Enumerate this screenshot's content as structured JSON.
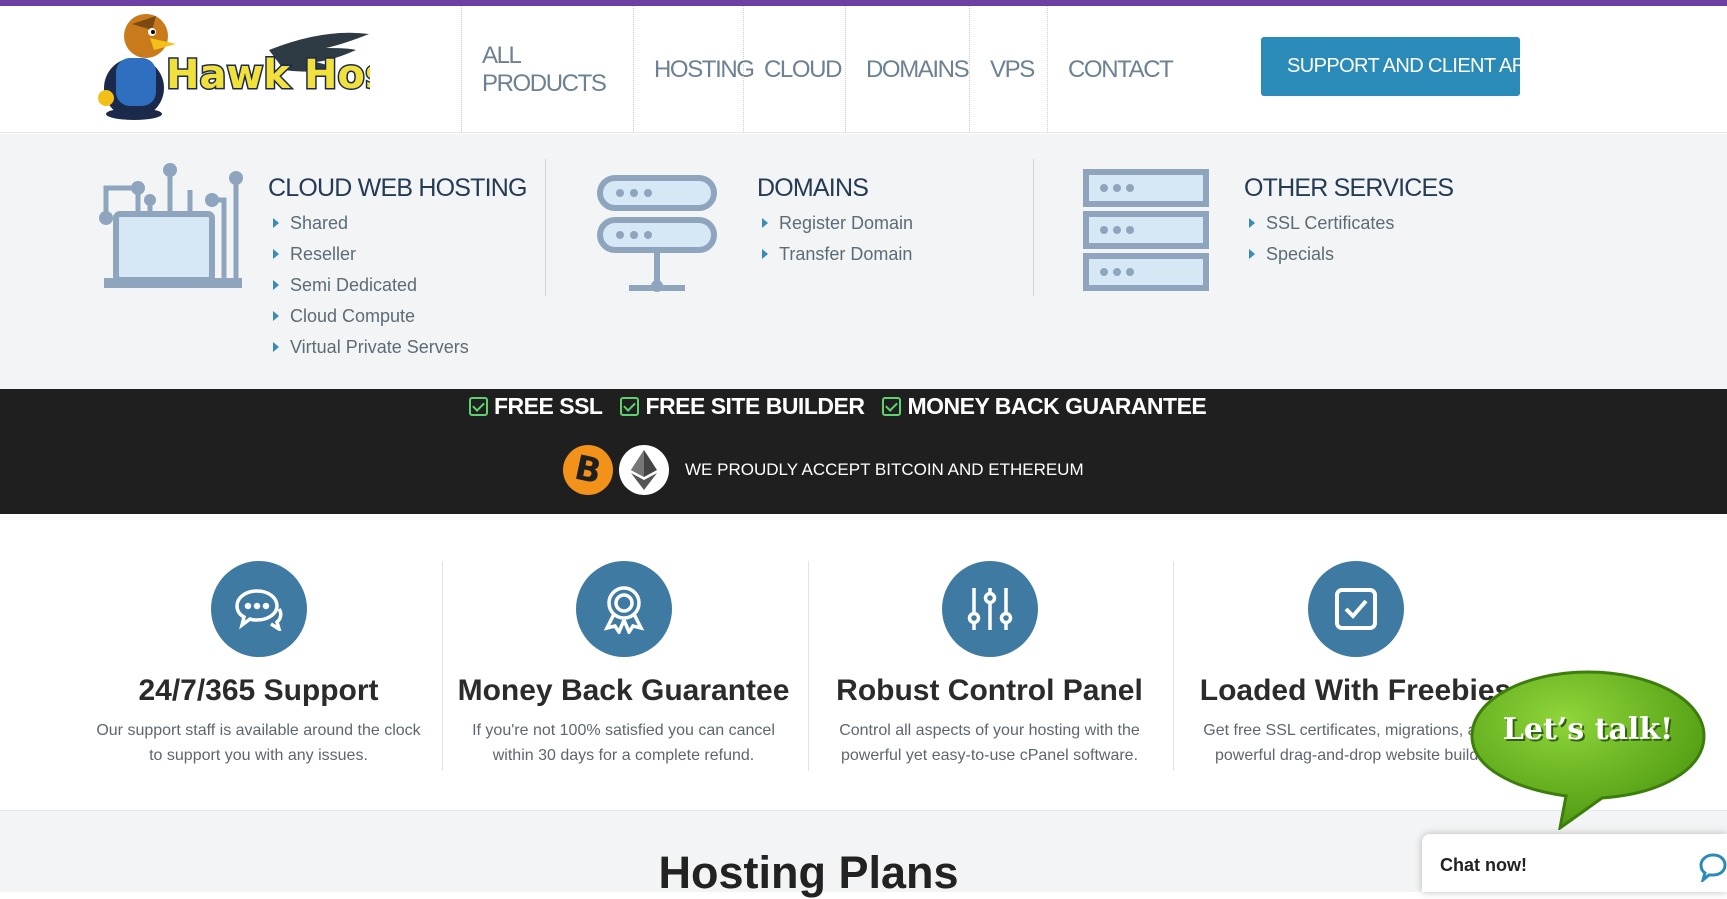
{
  "header": {
    "logo_text": "Hawk Host",
    "nav": [
      "ALL PRODUCTS",
      "HOSTING",
      "CLOUD",
      "DOMAINS",
      "VPS",
      "CONTACT"
    ],
    "support_button": "SUPPORT AND CLIENT AREA"
  },
  "mega_menu": {
    "hosting": {
      "title": "CLOUD WEB HOSTING",
      "items": [
        "Shared",
        "Reseller",
        "Semi Dedicated",
        "Cloud Compute",
        "Virtual Private Servers"
      ]
    },
    "domains": {
      "title": "DOMAINS",
      "items": [
        "Register Domain",
        "Transfer Domain"
      ]
    },
    "other": {
      "title": "OTHER SERVICES",
      "items": [
        "SSL Certificates",
        "Specials"
      ]
    }
  },
  "band": {
    "features": [
      "FREE SSL",
      "FREE SITE BUILDER",
      "MONEY BACK GUARANTEE"
    ],
    "crypto_text": "WE PROUDLY ACCEPT BITCOIN AND ETHEREUM"
  },
  "features": [
    {
      "title": "24/7/365 Support",
      "desc": "Our support staff is available around the clock to support you with any issues.",
      "icon": "chat-icon"
    },
    {
      "title": "Money Back Guarantee",
      "desc": "If you're not 100% satisfied you can cancel within 30 days for a complete refund.",
      "icon": "award-icon"
    },
    {
      "title": "Robust Control Panel",
      "desc": "Control all aspects of your hosting with the powerful yet easy-to-use cPanel software.",
      "icon": "sliders-icon"
    },
    {
      "title": "Loaded With Freebies",
      "desc": "Get free SSL certificates, migrations, and a powerful drag-and-drop website builder.",
      "icon": "checkbox-icon"
    }
  ],
  "plans": {
    "title": "Hosting Plans"
  },
  "chat": {
    "talk_label": "Let’s talk!",
    "chat_now": "Chat now!"
  },
  "colors": {
    "accent": "#2a8bb8",
    "top_bar": "#6e3fa3",
    "icon_circle": "#3e7aa1",
    "check_green": "#5fd16f",
    "talk_green": "#6cb61c"
  }
}
